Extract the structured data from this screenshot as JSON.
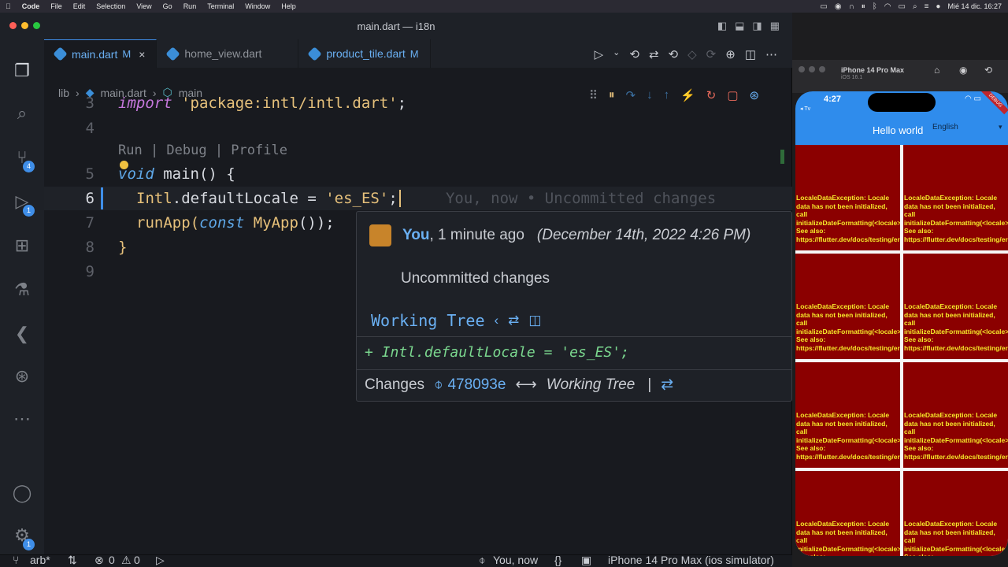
{
  "menubar": {
    "apple": "",
    "app": "Code",
    "items": [
      "File",
      "Edit",
      "Selection",
      "View",
      "Go",
      "Run",
      "Terminal",
      "Window",
      "Help"
    ],
    "clock": "Mié 14 dic.  16:27"
  },
  "window": {
    "title": "main.dart — i18n"
  },
  "tabs": [
    {
      "label": "main.dart",
      "modified": "M",
      "close": "×"
    },
    {
      "label": "home_view.dart"
    },
    {
      "label": "product_tile.dart",
      "modified": "M"
    }
  ],
  "activity_badges": {
    "scm": "4",
    "debug": "1",
    "settings": "1"
  },
  "breadcrumb": {
    "folder": "lib",
    "file": "main.dart",
    "symbol": "main"
  },
  "codelens": "Run | Debug | Profile",
  "code": {
    "line3_num": "3",
    "line3_kw": "import",
    "line3_str": "'package:intl/intl.dart'",
    "line3_end": ";",
    "line4_num": "4",
    "line5_num": "5",
    "line5_kw": "void",
    "line5_rest": " main() {",
    "line6_num": "6",
    "line6_a": "Intl",
    "line6_b": ".defaultLocale = ",
    "line6_str": "'es_ES'",
    "line6_end": ";",
    "line6_blame": "You, now • Uncommitted changes",
    "line7_num": "7",
    "line7_a": "runApp(",
    "line7_kw": "const",
    "line7_cls": "MyApp",
    "line7_end": "());",
    "line8_num": "8",
    "line8": "}",
    "line9_num": "9"
  },
  "hover": {
    "author": "You",
    "time": ", 1 minute ago",
    "date": "(December 14th, 2022 4:26 PM)",
    "message": "Uncommitted changes",
    "section": "Working Tree",
    "diff": "+ Intl.defaultLocale = 'es_ES';",
    "changes_label": "Changes",
    "commit": "478093e",
    "arrow": "⟷",
    "target": "Working Tree",
    "bar": "|"
  },
  "statusbar": {
    "branch": "arb*",
    "errors": "0",
    "warnings": "0",
    "blame": "You, now",
    "braces": "{}",
    "device": "iPhone 14 Pro Max (ios simulator)"
  },
  "simulator": {
    "device": "iPhone 14 Pro Max",
    "os": "iOS 16.1",
    "time": "4:27",
    "back": "◂ Tv",
    "banner": "DEBUG",
    "app_title": "Hello world",
    "language": "English",
    "error_text": "LocaleDataException: Locale data has not been initialized, call initializeDateFormatting(<locale>). See also: https://flutter.dev/docs/testing/errors"
  }
}
